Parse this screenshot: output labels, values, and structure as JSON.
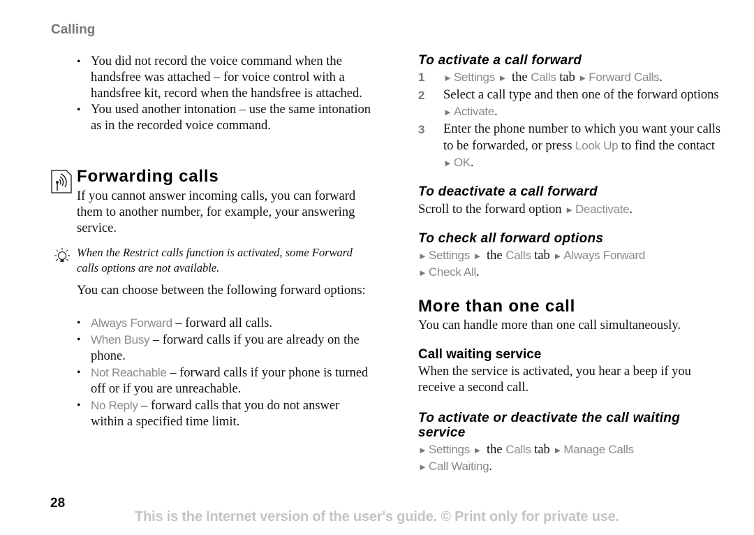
{
  "header": {
    "section": "Calling"
  },
  "troubleshoot_bullets": [
    "You did not record the voice command when the handsfree was attached – for voice control with a handsfree kit, record when the handsfree is attached.",
    "You used another intonation – use the same intonation as in the recorded voice command."
  ],
  "forwarding": {
    "icon": "network-service-icon",
    "title": "Forwarding calls",
    "intro": "If you cannot answer incoming calls, you can forward them to another number, for example, your answering service.",
    "tip_icon": "lightbulb-icon",
    "tip": "When the Restrict calls function is activated, some Forward calls options are not available.",
    "choose": "You can choose between the following forward options:",
    "options": [
      {
        "name": "Always Forward",
        "desc": " – forward all calls."
      },
      {
        "name": "When Busy",
        "desc": " – forward calls if you are already on the phone."
      },
      {
        "name": "Not Reachable",
        "desc": " – forward calls if your phone is turned off or if you are unreachable."
      },
      {
        "name": "No Reply",
        "desc": " – forward calls that you do not answer within a specified time limit."
      }
    ]
  },
  "activate": {
    "title": "To activate a call forward",
    "steps": [
      {
        "num": "1",
        "settings": "Settings",
        "the": " the ",
        "calls": "Calls",
        "tab": " tab ",
        "target": "Forward Calls",
        "end": "."
      },
      {
        "num": "2",
        "text": "Select a call type and then one of the forward options ",
        "action": "Activate",
        "end": "."
      },
      {
        "num": "3",
        "text": "Enter the phone number to which you want your calls to be forwarded, or press ",
        "lookup": "Look Up",
        "mid": " to find the contact ",
        "ok": "OK",
        "end": "."
      }
    ]
  },
  "deactivate": {
    "title": "To deactivate a call forward",
    "text": "Scroll to the forward option ",
    "action": "Deactivate",
    "end": "."
  },
  "check_all": {
    "title": "To check all forward options",
    "settings": "Settings",
    "the": " the ",
    "calls": "Calls",
    "tab": " tab ",
    "target": "Always Forward",
    "final": "Check All",
    "end": "."
  },
  "more_calls": {
    "title": "More than one call",
    "text": "You can handle more than one call simultaneously."
  },
  "call_waiting": {
    "title": "Call waiting service",
    "text": "When the service is activated, you hear a beep if you receive a second call."
  },
  "cw_toggle": {
    "title": "To activate or deactivate the call waiting service",
    "settings": "Settings",
    "the": " the ",
    "calls": "Calls",
    "tab": " tab ",
    "target": "Manage Calls",
    "final": "Call Waiting",
    "end": "."
  },
  "arrow": "►",
  "footer": {
    "page_number": "28",
    "notice": "This is the Internet version of the user's guide. © Print only for private use."
  }
}
